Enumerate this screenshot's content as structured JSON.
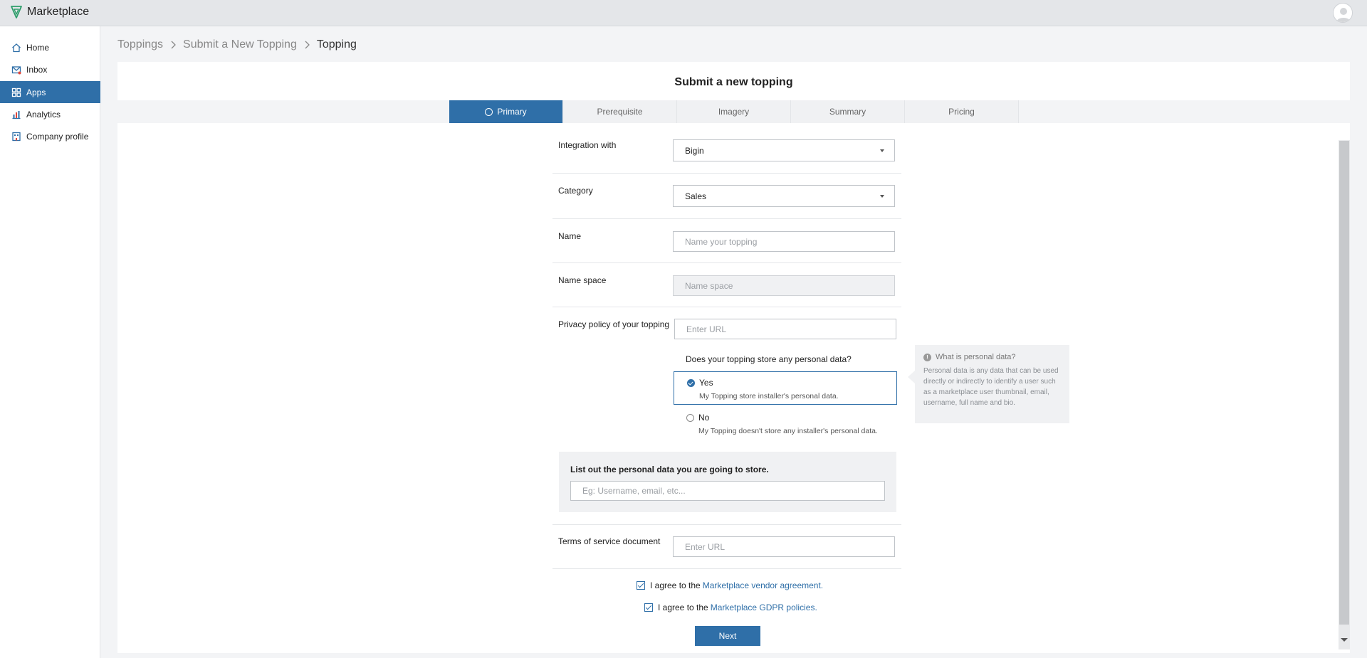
{
  "app": {
    "title": "Marketplace"
  },
  "sidebar": {
    "items": [
      {
        "label": "Home",
        "icon": "home-icon"
      },
      {
        "label": "Inbox",
        "icon": "inbox-icon"
      },
      {
        "label": "Apps",
        "icon": "apps-grid-icon",
        "active": true
      },
      {
        "label": "Analytics",
        "icon": "analytics-icon"
      },
      {
        "label": "Company profile",
        "icon": "company-icon"
      }
    ]
  },
  "breadcrumb": {
    "items": [
      "Toppings",
      "Submit a New Topping",
      "Topping"
    ]
  },
  "form": {
    "title": "Submit a new topping",
    "tabs": [
      {
        "label": "Primary",
        "active": true
      },
      {
        "label": "Prerequisite"
      },
      {
        "label": "Imagery"
      },
      {
        "label": "Summary"
      },
      {
        "label": "Pricing"
      }
    ],
    "integration": {
      "label": "Integration with",
      "value": "Bigin"
    },
    "category": {
      "label": "Category",
      "value": "Sales"
    },
    "name": {
      "label": "Name",
      "placeholder": "Name your topping"
    },
    "namespace": {
      "label": "Name space",
      "placeholder": "Name space"
    },
    "privacy": {
      "label": "Privacy policy of your topping",
      "placeholder": "Enter URL"
    },
    "personal_data": {
      "question": "Does your topping store any personal data?",
      "yes": {
        "title": "Yes",
        "desc": "My Topping store installer's personal data.",
        "selected": true
      },
      "no": {
        "title": "No",
        "desc": "My Topping doesn't store any installer's personal data."
      }
    },
    "info": {
      "title": "What is personal data?",
      "body": "Personal data is any data that can be used directly or indirectly to identify a user such as a marketplace user thumbnail, email, username, full name and bio."
    },
    "personal_list": {
      "title": "List out the personal data you are going to store.",
      "placeholder": "Eg: Username, email, etc..."
    },
    "terms": {
      "label": "Terms of service document",
      "placeholder": "Enter URL"
    },
    "agreements": {
      "vendor": {
        "prefix": "I agree to the ",
        "link": "Marketplace vendor agreement."
      },
      "gdpr": {
        "prefix": "I agree to the ",
        "link": "Marketplace GDPR policies."
      }
    },
    "next_label": "Next"
  },
  "colors": {
    "accent": "#2f6fa8",
    "brand_logo": "#2e9e6b"
  }
}
